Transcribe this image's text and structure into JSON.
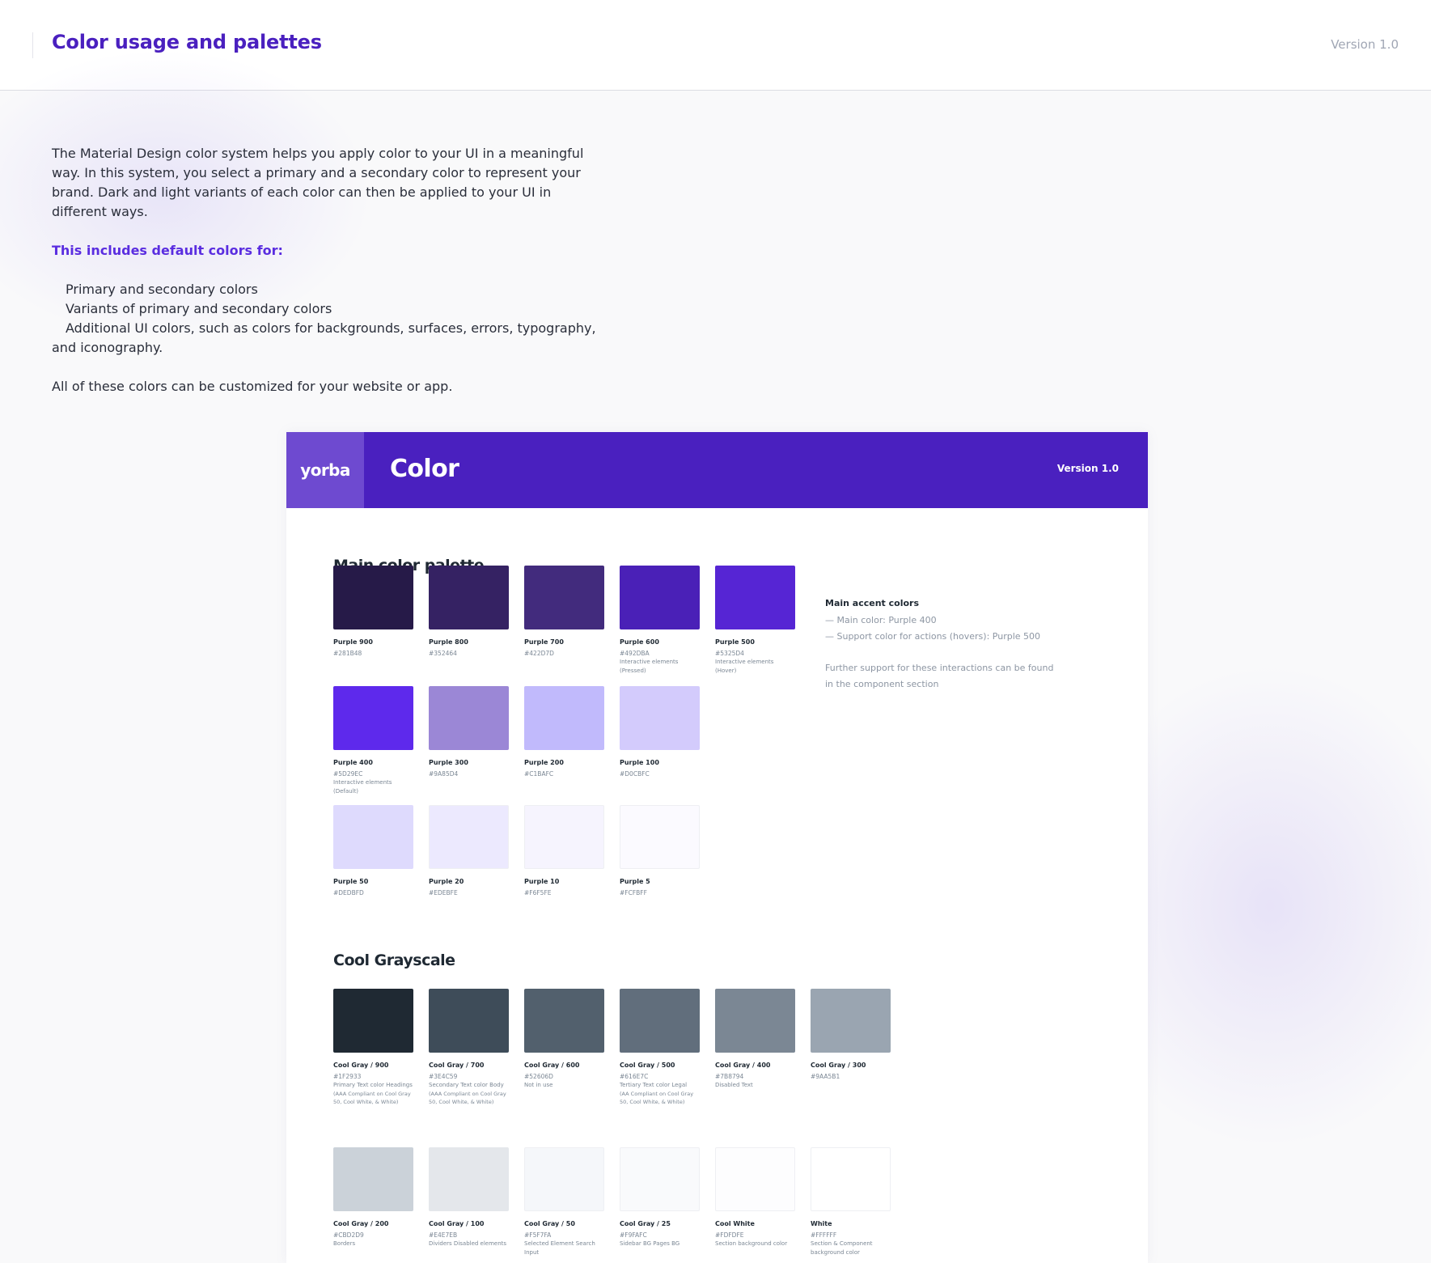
{
  "header": {
    "title": "Color usage and palettes",
    "version": "Version 1.0"
  },
  "intro": {
    "paragraph": "The Material Design color system helps you apply color to your UI in a meaningful way. In this system, you select a primary and a secondary color to represent your brand. Dark and light variants of each color can then be applied to your UI in different ways.",
    "subheading": "This includes default colors for:",
    "bullets": [
      "Primary and secondary colors",
      "Variants of primary and secondary colors",
      "Additional UI colors, such as colors for backgrounds, surfaces, errors, typography, and iconography."
    ],
    "closing": "All of these colors can be customized for your website or app."
  },
  "card": {
    "logo": "yorba",
    "title": "Color",
    "version": "Version 1.0",
    "main_palette": {
      "title": "Main color palette",
      "swatches": [
        {
          "name": "Purple 900",
          "hex": "#281B48",
          "color": "#261a48",
          "note": ""
        },
        {
          "name": "Purple 800",
          "hex": "#352464",
          "color": "#352263",
          "note": ""
        },
        {
          "name": "Purple 700",
          "hex": "#422D7D",
          "color": "#422b7d",
          "note": ""
        },
        {
          "name": "Purple 600",
          "hex": "#492DBA",
          "color": "#4a20b7",
          "note": "Interactive elements (Pressed)"
        },
        {
          "name": "Purple 500",
          "hex": "#5325D4",
          "color": "#5625d4",
          "note": "Interactive elements (Hover)"
        },
        {
          "name": "Purple 400",
          "hex": "#5D29EC",
          "color": "#5e29ec",
          "note": "Interactive elements (Default)"
        },
        {
          "name": "Purple 300",
          "hex": "#9A85D4",
          "color": "#9b87d6",
          "note": ""
        },
        {
          "name": "Purple 200",
          "hex": "#C1BAFC",
          "color": "#c1bafc",
          "note": ""
        },
        {
          "name": "Purple 100",
          "hex": "#D0CBFC",
          "color": "#d3cbfc",
          "note": ""
        },
        {
          "name": "Purple 50",
          "hex": "#DEDBFD",
          "color": "#dedafd",
          "note": ""
        },
        {
          "name": "Purple 20",
          "hex": "#EDEBFE",
          "color": "#ece9fe",
          "note": ""
        },
        {
          "name": "Purple 10",
          "hex": "#F6F5FE",
          "color": "#f6f4fe",
          "note": ""
        },
        {
          "name": "Purple 5",
          "hex": "#FCFBFF",
          "color": "#fbfaff",
          "note": ""
        }
      ]
    },
    "accent": {
      "title": "Main accent colors",
      "lines": [
        "— Main color: Purple 400",
        "— Support color for actions (hovers): Purple 500"
      ],
      "footnote": "Further support for these interactions can be found in the component section"
    },
    "grayscale": {
      "title": "Cool Grayscale",
      "swatches": [
        {
          "name": "Cool Gray / 900",
          "hex": "#1F2933",
          "color": "#1f2933",
          "note": "Primary Text color Headings",
          "note_small": "(AAA Compliant on Cool Gray 50, Cool White, & White)"
        },
        {
          "name": "Cool Gray / 700",
          "hex": "#3E4C59",
          "color": "#3e4c59",
          "note": "Secondary Text color Body",
          "note_small": "(AAA Compliant on Cool Gray 50, Cool White, & White)"
        },
        {
          "name": "Cool Gray / 600",
          "hex": "#52606D",
          "color": "#52606d",
          "note": "Not in use",
          "note_small": ""
        },
        {
          "name": "Cool Gray / 500",
          "hex": "#616E7C",
          "color": "#616e7c",
          "note": "Tertiary Text color Legal",
          "note_small": "(AA Compliant on Cool Gray 50, Cool White, & White)"
        },
        {
          "name": "Cool Gray / 400",
          "hex": "#7B8794",
          "color": "#7b8794",
          "note": "Disabled Text",
          "note_small": ""
        },
        {
          "name": "Cool Gray / 300",
          "hex": "#9AA5B1",
          "color": "#9aa5b1",
          "note": "",
          "note_small": ""
        },
        {
          "name": "Cool Gray / 200",
          "hex": "#CBD2D9",
          "color": "#cbd2d9",
          "note": "Borders",
          "note_small": ""
        },
        {
          "name": "Cool Gray / 100",
          "hex": "#E4E7EB",
          "color": "#e4e7eb",
          "note": "Dividers Disabled elements",
          "note_small": ""
        },
        {
          "name": "Cool Gray / 50",
          "hex": "#F5F7FA",
          "color": "#f5f7fa",
          "note": "Selected Element Search Input",
          "note_small": ""
        },
        {
          "name": "Cool Gray / 25",
          "hex": "#F9FAFC",
          "color": "#f9fafc",
          "note": "Sidebar BG Pages BG",
          "note_small": ""
        },
        {
          "name": "Cool White",
          "hex": "#FDFDFE",
          "color": "#fdfdfe",
          "note": "Section background color",
          "note_small": ""
        },
        {
          "name": "White",
          "hex": "#FFFFFF",
          "color": "#ffffff",
          "note": "Section & Component background color",
          "note_small": ""
        }
      ]
    }
  }
}
